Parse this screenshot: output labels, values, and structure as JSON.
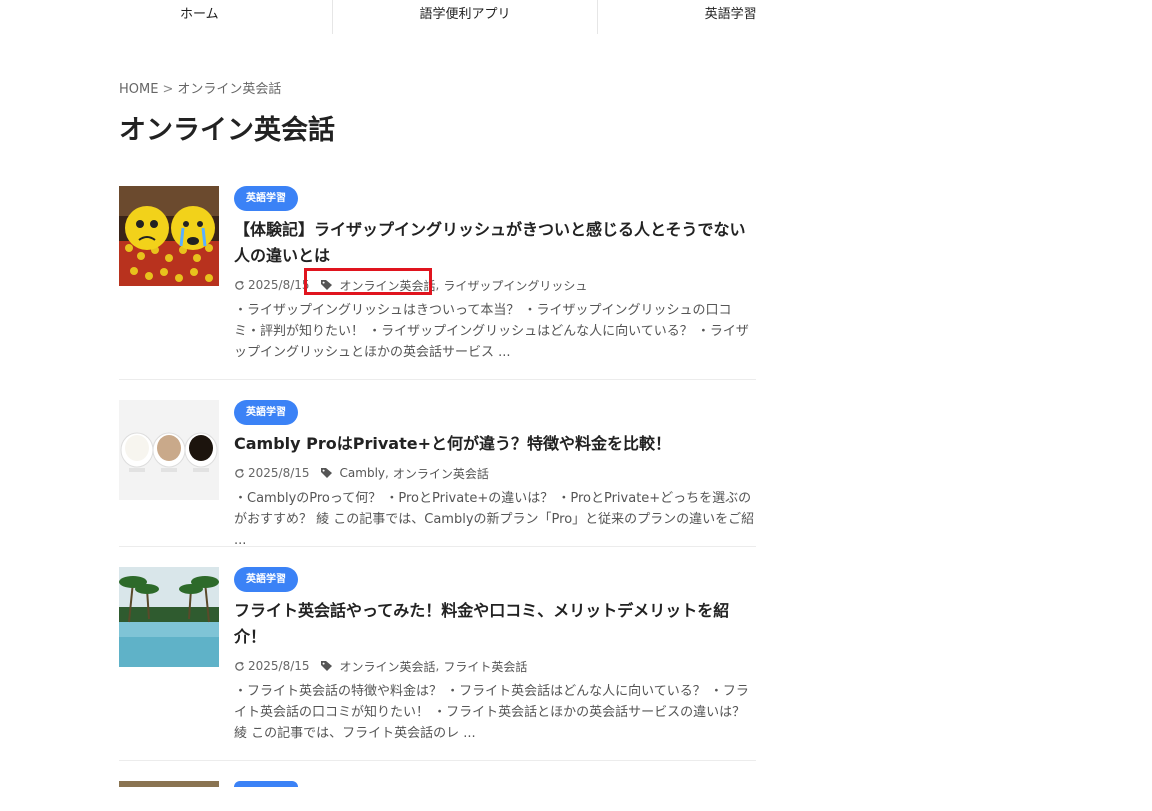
{
  "nav": {
    "items": [
      "ホーム",
      "語学便利アプリ",
      "英語学習"
    ]
  },
  "breadcrumb": {
    "home": "HOME",
    "separator": ">",
    "current": "オンライン英会話"
  },
  "page_title": "オンライン英会話",
  "posts": [
    {
      "category": "英語学習",
      "title": "【体験記】ライザップイングリッシュがきついと感じる人とそうでない人の違いとは",
      "date": "2025/8/15",
      "tags": [
        "オンライン英会話",
        "ライザップイングリッシュ"
      ],
      "excerpt": "・ライザップイングリッシュはきついって本当？ ・ライザップイングリッシュの口コミ・評判が知りたい！ ・ライザップイングリッシュはどんな人に向いている？ ・ライザップイングリッシュとほかの英会話サービス ..."
    },
    {
      "category": "英語学習",
      "title": "Cambly ProはPrivate+と何が違う？特徴や料金を比較！",
      "date": "2025/8/15",
      "tags": [
        "Cambly",
        "オンライン英会話"
      ],
      "excerpt": "・CamblyのProって何？ ・ProとPrivate+の違いは？ ・ProとPrivate+どっちを選ぶのがおすすめ？ 綾 この記事では、Camblyの新プラン「Pro」と従来のプランの違いをご紹 ..."
    },
    {
      "category": "英語学習",
      "title": "フライト英会話やってみた！料金や口コミ、メリットデメリットを紹介！",
      "date": "2025/8/15",
      "tags": [
        "オンライン英会話",
        "フライト英会話"
      ],
      "excerpt": "・フライト英会話の特徴や料金は？ ・フライト英会話はどんな人に向いている？ ・フライト英会話の口コミが知りたい！ ・フライト英会話とほかの英会話サービスの違いは？ 綾 この記事では、フライト英会話のレ ..."
    }
  ],
  "colors": {
    "accent": "#3b82f6",
    "highlight": "#e0141e"
  }
}
